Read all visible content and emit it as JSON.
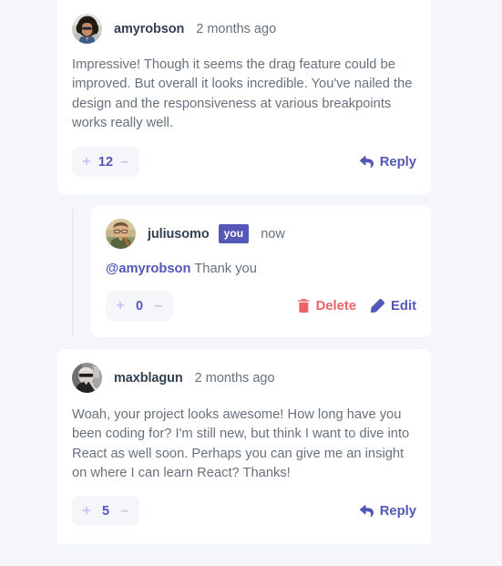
{
  "theme": {
    "page_background": "#f5f6fa",
    "card_background": "#ffffff",
    "username_color": "#334253",
    "body_text_color": "#67727e",
    "accent_indigo": "#5357b6",
    "accent_soft_indigo": "#c5c6ef",
    "danger_red": "#ed6368",
    "thread_line_color": "#e9ebf0",
    "badge_background": "#5357b6",
    "badge_text_color": "#ffffff",
    "vote_pill_background": "#f5f6fa"
  },
  "labels": {
    "reply": "Reply",
    "delete": "Delete",
    "edit": "Edit",
    "upvote": "+",
    "downvote": "–",
    "you_badge": "you"
  },
  "icons": {
    "reply": "reply-arrow-icon",
    "delete": "trash-icon",
    "edit": "pencil-icon",
    "upvote": "plus-icon",
    "downvote": "minus-icon"
  },
  "comments": [
    {
      "id": "comment-amyrobson",
      "username": "amyrobson",
      "avatar": "avatar-amyrobson",
      "timestamp": "2 months ago",
      "is_you": false,
      "score": "12",
      "body": "Impressive! Though it seems the drag feature could be improved. But overall it looks incredible. You've nailed the design and the responsiveness at various breakpoints works really well."
    },
    {
      "id": "reply-juliusomo",
      "username": "juliusomo",
      "avatar": "avatar-juliusomo",
      "timestamp": "now",
      "is_you": true,
      "score": "0",
      "mention": "@amyrobson",
      "body": " Thank you"
    },
    {
      "id": "comment-maxblagun",
      "username": "maxblagun",
      "avatar": "avatar-maxblagun",
      "timestamp": "2 months ago",
      "is_you": false,
      "score": "5",
      "body": "Woah, your project looks awesome! How long have you been coding for? I'm still new, but think I want to dive into React as well soon. Perhaps you can give me an insight on where I can learn React? Thanks!"
    }
  ]
}
